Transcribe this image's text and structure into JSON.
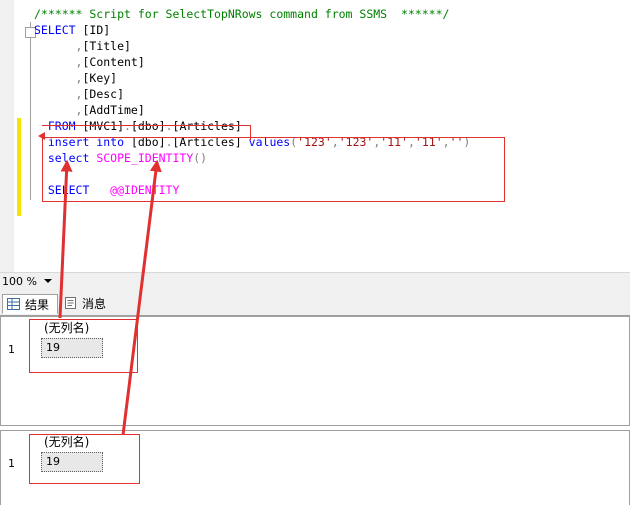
{
  "editor": {
    "lines": [
      {
        "parts": [
          {
            "t": "/****** Script for SelectTopNRows command from SSMS  ******/",
            "c": "cm"
          }
        ]
      },
      {
        "parts": [
          {
            "t": "SELECT ",
            "c": "kw"
          },
          {
            "t": "[ID]",
            "c": ""
          }
        ]
      },
      {
        "parts": [
          {
            "t": "      ,",
            "c": "gr"
          },
          {
            "t": "[Title]",
            "c": ""
          }
        ]
      },
      {
        "parts": [
          {
            "t": "      ,",
            "c": "gr"
          },
          {
            "t": "[Content]",
            "c": ""
          }
        ]
      },
      {
        "parts": [
          {
            "t": "      ,",
            "c": "gr"
          },
          {
            "t": "[Key]",
            "c": ""
          }
        ]
      },
      {
        "parts": [
          {
            "t": "      ,",
            "c": "gr"
          },
          {
            "t": "[Desc]",
            "c": ""
          }
        ]
      },
      {
        "parts": [
          {
            "t": "      ,",
            "c": "gr"
          },
          {
            "t": "[AddTime]",
            "c": ""
          }
        ]
      },
      {
        "parts": [
          {
            "t": "  FROM ",
            "c": "kw"
          },
          {
            "t": "[MVC1]",
            "c": ""
          },
          {
            "t": ".",
            "c": "gr"
          },
          {
            "t": "[dbo]",
            "c": ""
          },
          {
            "t": ".",
            "c": "gr"
          },
          {
            "t": "[Articles]",
            "c": ""
          }
        ]
      },
      {
        "parts": [
          {
            "t": "  insert into ",
            "c": "kw"
          },
          {
            "t": "[dbo]",
            "c": ""
          },
          {
            "t": ".",
            "c": "gr"
          },
          {
            "t": "[Articles] ",
            "c": ""
          },
          {
            "t": "values",
            "c": "kw"
          },
          {
            "t": "(",
            "c": "gr"
          },
          {
            "t": "'123'",
            "c": "st"
          },
          {
            "t": ",",
            "c": "gr"
          },
          {
            "t": "'123'",
            "c": "st"
          },
          {
            "t": ",",
            "c": "gr"
          },
          {
            "t": "'11'",
            "c": "st"
          },
          {
            "t": ",",
            "c": "gr"
          },
          {
            "t": "'11'",
            "c": "st"
          },
          {
            "t": ",",
            "c": "gr"
          },
          {
            "t": "''",
            "c": "st"
          },
          {
            "t": ")",
            "c": "gr"
          }
        ]
      },
      {
        "parts": [
          {
            "t": "  select ",
            "c": "kw"
          },
          {
            "t": "SCOPE_IDENTITY",
            "c": "fn"
          },
          {
            "t": "()",
            "c": "gr"
          }
        ]
      },
      {
        "parts": [
          {
            "t": "",
            "c": ""
          }
        ]
      },
      {
        "parts": [
          {
            "t": "  SELECT   ",
            "c": "kw"
          },
          {
            "t": "@@IDENTITY",
            "c": "fn"
          }
        ]
      }
    ]
  },
  "zoom": {
    "value": "100 %"
  },
  "tabs": [
    {
      "label": "结果",
      "active": true
    },
    {
      "label": "消息",
      "active": false
    }
  ],
  "results": [
    {
      "column": "(无列名)",
      "row": "1",
      "value": "19"
    },
    {
      "column": "(无列名)",
      "row": "1",
      "value": "19"
    }
  ],
  "colors": {
    "annotation": "#e03030",
    "keyword": "#0000ff",
    "comment": "#008000",
    "string": "#a31515",
    "function": "#ff00ff"
  }
}
